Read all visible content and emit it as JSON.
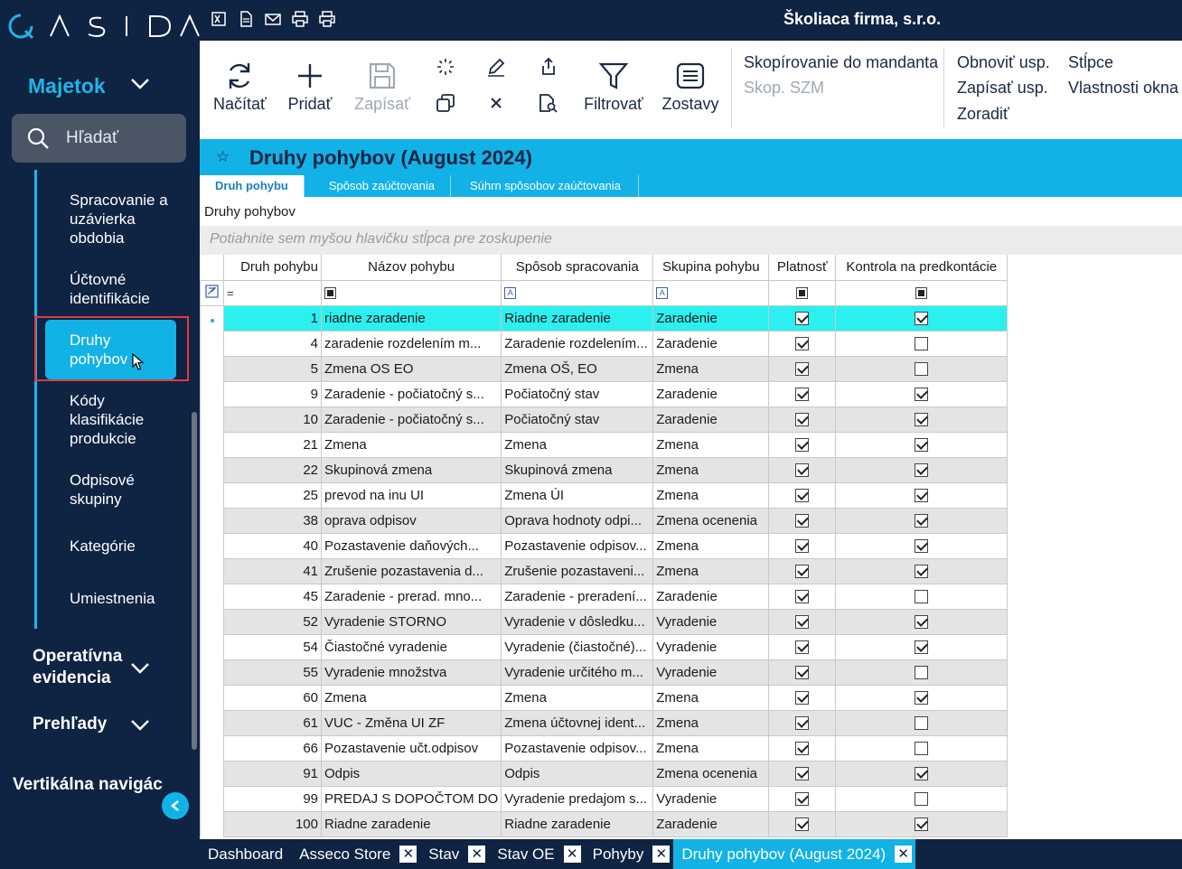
{
  "app": {
    "company": "Školiaca firma, s.r.o.",
    "logo_text": "ΛSIDΛ"
  },
  "sidebar": {
    "module": "Majetok",
    "search_placeholder": "Hľadať",
    "items": [
      {
        "label": "Spracovanie a uzávierka obdobia"
      },
      {
        "label": "Účtovné identifikácie"
      },
      {
        "label": "Druhy pohybov"
      },
      {
        "label": "Kódy klasifikácie produkcie"
      },
      {
        "label": "Odpisové skupiny"
      },
      {
        "label": "Kategórie"
      },
      {
        "label": "Umiestnenia"
      }
    ],
    "groups": [
      {
        "label": "Operatívna evidencia"
      },
      {
        "label": "Prehľady"
      }
    ],
    "vertical_nav": "Vertikálna navigác"
  },
  "toolbar": {
    "nacitat": "Načítať",
    "pridat": "Pridať",
    "zapisat": "Zapísať",
    "filtrovat": "Filtrovať",
    "zostavy": "Zostavy",
    "copy_mandant": "Skopírovanie do mandanta",
    "copy_szm": "Skop. SZM",
    "obnovit": "Obnoviť usp.",
    "zapisat_usp": "Zapísať usp.",
    "zoradit": "Zoradiť",
    "stlpce": "Stĺpce",
    "vlastnosti": "Vlastnosti okna"
  },
  "window": {
    "title": "Druhy pohybov (August 2024)",
    "tabs": [
      "Druh pohybu",
      "Spôsob zaúčtovania",
      "Súhrn spôsobov zaúčtovania"
    ],
    "section_label": "Druhy pohybov",
    "group_hint": "Potiahnite sem myšou hlavičku stĺpca pre zoskupenie"
  },
  "grid": {
    "columns": [
      "Druh pohybu",
      "Názov pohybu",
      "Spôsob spracovania",
      "Skupina pohybu",
      "Platnosť",
      "Kontrola na predkontácie"
    ],
    "filter_eq": "=",
    "filter_a": "A",
    "rows": [
      {
        "id": "1",
        "name": "riadne zaradenie",
        "way": "Riadne zaradenie",
        "group": "Zaradenie",
        "valid": true,
        "check": true
      },
      {
        "id": "4",
        "name": "zaradenie rozdelením m...",
        "way": "Zaradenie rozdelením...",
        "group": "Zaradenie",
        "valid": true,
        "check": false
      },
      {
        "id": "5",
        "name": "Zmena OS EO",
        "way": "Zmena OŠ, EO",
        "group": "Zmena",
        "valid": true,
        "check": false
      },
      {
        "id": "9",
        "name": "Zaradenie - počiatočný s...",
        "way": "Počiatočný stav",
        "group": "Zaradenie",
        "valid": true,
        "check": true
      },
      {
        "id": "10",
        "name": "Zaradenie - počiatočný s...",
        "way": "Počiatočný stav",
        "group": "Zaradenie",
        "valid": true,
        "check": true
      },
      {
        "id": "21",
        "name": "Zmena",
        "way": "Zmena",
        "group": "Zmena",
        "valid": true,
        "check": true
      },
      {
        "id": "22",
        "name": "Skupinová zmena",
        "way": "Skupinová zmena",
        "group": "Zmena",
        "valid": true,
        "check": true
      },
      {
        "id": "25",
        "name": "prevod na inu UI",
        "way": "Zmena ÚI",
        "group": "Zmena",
        "valid": true,
        "check": true
      },
      {
        "id": "38",
        "name": "oprava odpisov",
        "way": "Oprava hodnoty odpi...",
        "group": "Zmena ocenenia",
        "valid": true,
        "check": true
      },
      {
        "id": "40",
        "name": "Pozastavenie daňových...",
        "way": "Pozastavenie odpisov...",
        "group": "Zmena",
        "valid": true,
        "check": true
      },
      {
        "id": "41",
        "name": "Zrušenie pozastavenia d...",
        "way": "Zrušenie pozastaveni...",
        "group": "Zmena",
        "valid": true,
        "check": true
      },
      {
        "id": "45",
        "name": "Zaradenie - prerad. mno...",
        "way": "Zaradenie - preradení...",
        "group": "Zaradenie",
        "valid": true,
        "check": false
      },
      {
        "id": "52",
        "name": "Vyradenie STORNO",
        "way": "Vyradenie v dôsledku...",
        "group": "Vyradenie",
        "valid": true,
        "check": true
      },
      {
        "id": "54",
        "name": "Čiastočné vyradenie",
        "way": "Vyradenie (čiastočné)...",
        "group": "Vyradenie",
        "valid": true,
        "check": true
      },
      {
        "id": "55",
        "name": "Vyradenie množstva",
        "way": "Vyradenie určitého m...",
        "group": "Vyradenie",
        "valid": true,
        "check": false
      },
      {
        "id": "60",
        "name": "Zmena",
        "way": "Zmena",
        "group": "Zmena",
        "valid": true,
        "check": true
      },
      {
        "id": "61",
        "name": "VUC - Změna UI ZF",
        "way": "Zmena účtovnej ident...",
        "group": "Zmena",
        "valid": true,
        "check": false
      },
      {
        "id": "66",
        "name": "Pozastavenie učt.odpisov",
        "way": "Pozastavenie odpisov...",
        "group": "Zmena",
        "valid": true,
        "check": false
      },
      {
        "id": "91",
        "name": "Odpis",
        "way": "Odpis",
        "group": "Zmena ocenenia",
        "valid": true,
        "check": true
      },
      {
        "id": "99",
        "name": "PREDAJ S DOPOČTOM DO",
        "way": "Vyradenie predajom s...",
        "group": "Vyradenie",
        "valid": true,
        "check": false
      },
      {
        "id": "100",
        "name": "Riadne zaradenie",
        "way": "Riadne zaradenie",
        "group": "Zaradenie",
        "valid": true,
        "check": true
      }
    ]
  },
  "bottom_tabs": [
    {
      "label": "Dashboard",
      "closable": false
    },
    {
      "label": "Asseco Store",
      "closable": true
    },
    {
      "label": "Stav",
      "closable": true
    },
    {
      "label": "Stav OE",
      "closable": true
    },
    {
      "label": "Pohyby",
      "closable": true
    },
    {
      "label": "Druhy pohybov (August 2024)",
      "closable": true,
      "active": true
    }
  ],
  "colors": {
    "navy": "#0f2343",
    "accent": "#12b2e6",
    "selected_row": "#2cf0f0",
    "highlight": "#e23a3a"
  }
}
